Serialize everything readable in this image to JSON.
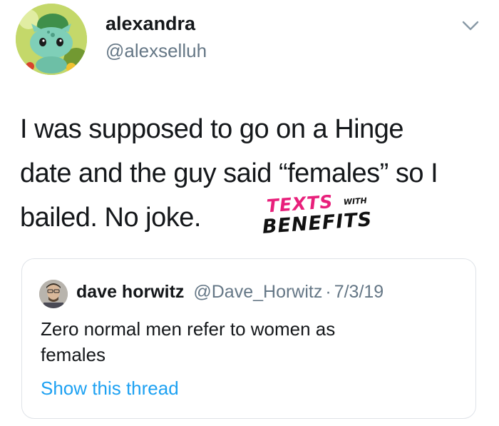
{
  "tweet": {
    "author": {
      "display_name": "alexandra",
      "handle": "@alexselluh",
      "avatar_icon": "bulbasaur-avatar"
    },
    "menu_icon": "chevron-down-icon",
    "text_lines": [
      "I was supposed to go on a Hinge",
      "date and the guy said “females” so I",
      "bailed. No joke."
    ]
  },
  "watermark": {
    "texts": "TEXTS",
    "with": "WITH",
    "benefits": "BENEFITS",
    "accent_color": "#e8207b"
  },
  "quoted_tweet": {
    "author": {
      "display_name": "dave horwitz",
      "handle": "@Dave_Horwitz",
      "separator": "·",
      "date": "7/3/19",
      "avatar_icon": "user-avatar"
    },
    "text_lines": [
      "Zero normal men refer to women as",
      "females"
    ],
    "show_thread": "Show this thread"
  },
  "colors": {
    "text_primary": "#14171a",
    "text_secondary": "#657786",
    "link": "#1da1f2",
    "border": "#dfe3e8"
  }
}
